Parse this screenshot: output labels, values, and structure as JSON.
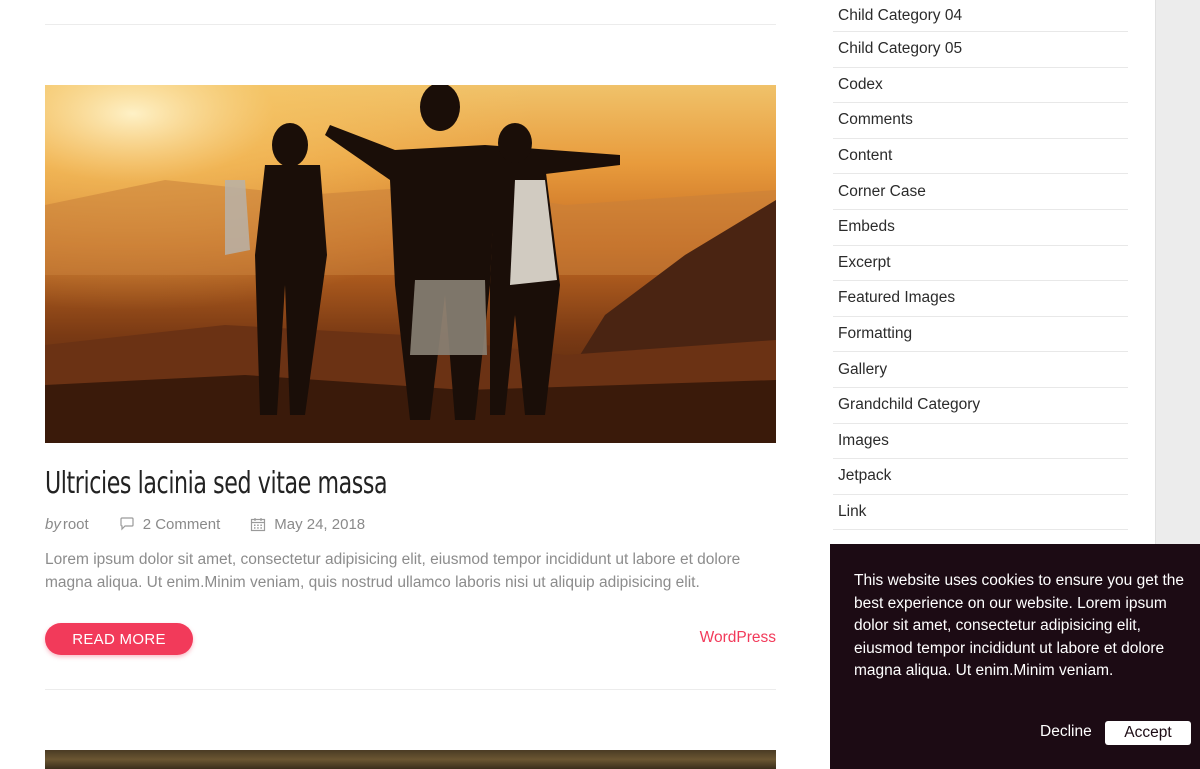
{
  "post": {
    "title": "Ultricies lacinia sed vitae massa",
    "by_label": "by",
    "author": "root",
    "comments": "2 Comment",
    "date": "May 24, 2018",
    "excerpt": "Lorem ipsum dolor sit amet, consectetur adipisicing elit, eiusmod tempor incididunt ut labore et dolore magna aliqua. Ut enim.Minim veniam, quis nostrud ullamco laboris nisi ut aliquip adipisicing elit.",
    "read_more_label": "READ MORE",
    "category": "WordPress"
  },
  "sidebar": {
    "categories": [
      "Child Category 04",
      "Child Category 05",
      "Codex",
      "Comments",
      "Content",
      "Corner Case",
      "Embeds",
      "Excerpt",
      "Featured Images",
      "Formatting",
      "Gallery",
      "Grandchild Category",
      "Images",
      "Jetpack",
      "Link"
    ]
  },
  "cookie_notice": {
    "text": "This website uses cookies to ensure you get the best experience on our website. Lorem ipsum dolor sit amet, consectetur adipisicing elit, eiusmod tempor incididunt ut labore et dolore magna aliqua. Ut enim.Minim veniam.",
    "decline_label": "Decline",
    "accept_label": "Accept"
  },
  "colors": {
    "accent": "#f23a5a",
    "cookie_bg": "#1c0b14"
  }
}
